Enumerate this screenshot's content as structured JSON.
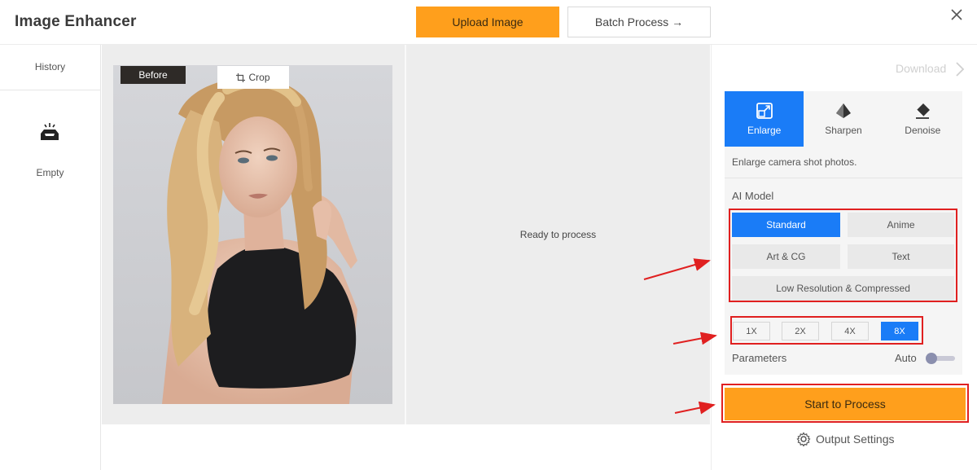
{
  "header": {
    "title": "Image Enhancer",
    "upload_label": "Upload Image",
    "batch_label": "Batch Process →"
  },
  "history": {
    "title": "History",
    "empty_label": "Empty"
  },
  "canvas": {
    "before_label": "Before",
    "crop_label": "Crop",
    "ready_text": "Ready to process"
  },
  "right": {
    "download_label": "Download",
    "tabs": [
      {
        "label": "Enlarge",
        "icon": "enlarge-icon",
        "active": true
      },
      {
        "label": "Sharpen",
        "icon": "sharpen-icon",
        "active": false
      },
      {
        "label": "Denoise",
        "icon": "eraser-icon",
        "active": false
      }
    ],
    "description": "Enlarge camera shot photos.",
    "ai_model_label": "AI Model",
    "models": [
      "Standard",
      "Anime",
      "Art & CG",
      "Text",
      "Low Resolution & Compressed"
    ],
    "selected_model": "Standard",
    "scales": [
      "1X",
      "2X",
      "4X",
      "8X"
    ],
    "selected_scale": "8X",
    "parameters_label": "Parameters",
    "auto_label": "Auto",
    "start_label": "Start to Process",
    "output_settings_label": "Output Settings"
  },
  "colors": {
    "accent_orange": "#ff9f1c",
    "accent_blue": "#1a7cf7",
    "annotation_red": "#e02020"
  }
}
